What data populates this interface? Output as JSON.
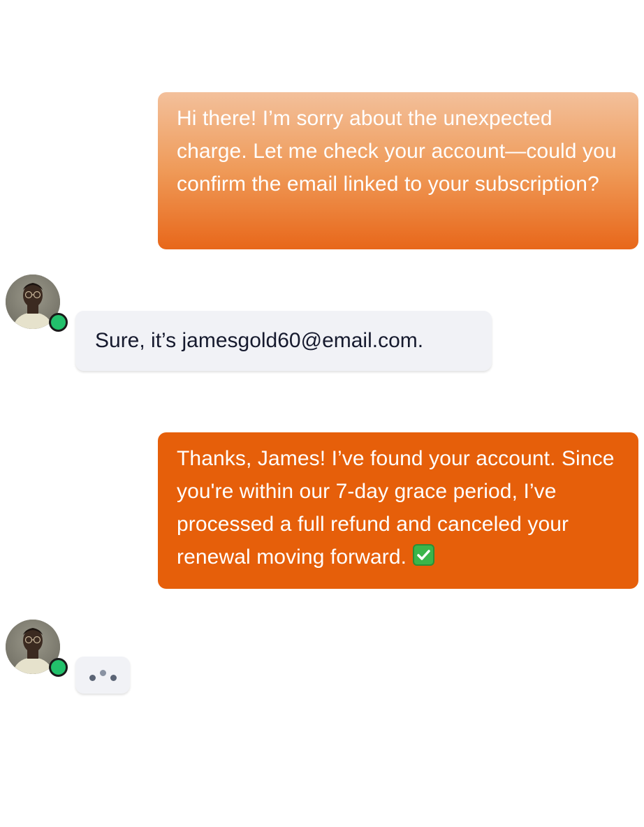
{
  "messages": {
    "agent_1": "Hi there! I’m sorry about the unexpected charge. Let me check your account—could you confirm the email linked to your subscription?",
    "user_1": "Sure, it’s jamesgold60@email.com.",
    "agent_2": "Thanks, James! I’ve found your account. Since you're within our 7-day grace period, I’ve processed a full refund and canceled your renewal moving forward.",
    "agent_2_emoji": "check-mark-icon"
  },
  "status": {
    "online_color": "#22c06b"
  },
  "colors": {
    "agent_bubble": "#e65f0a",
    "user_bubble": "#f1f2f6"
  }
}
